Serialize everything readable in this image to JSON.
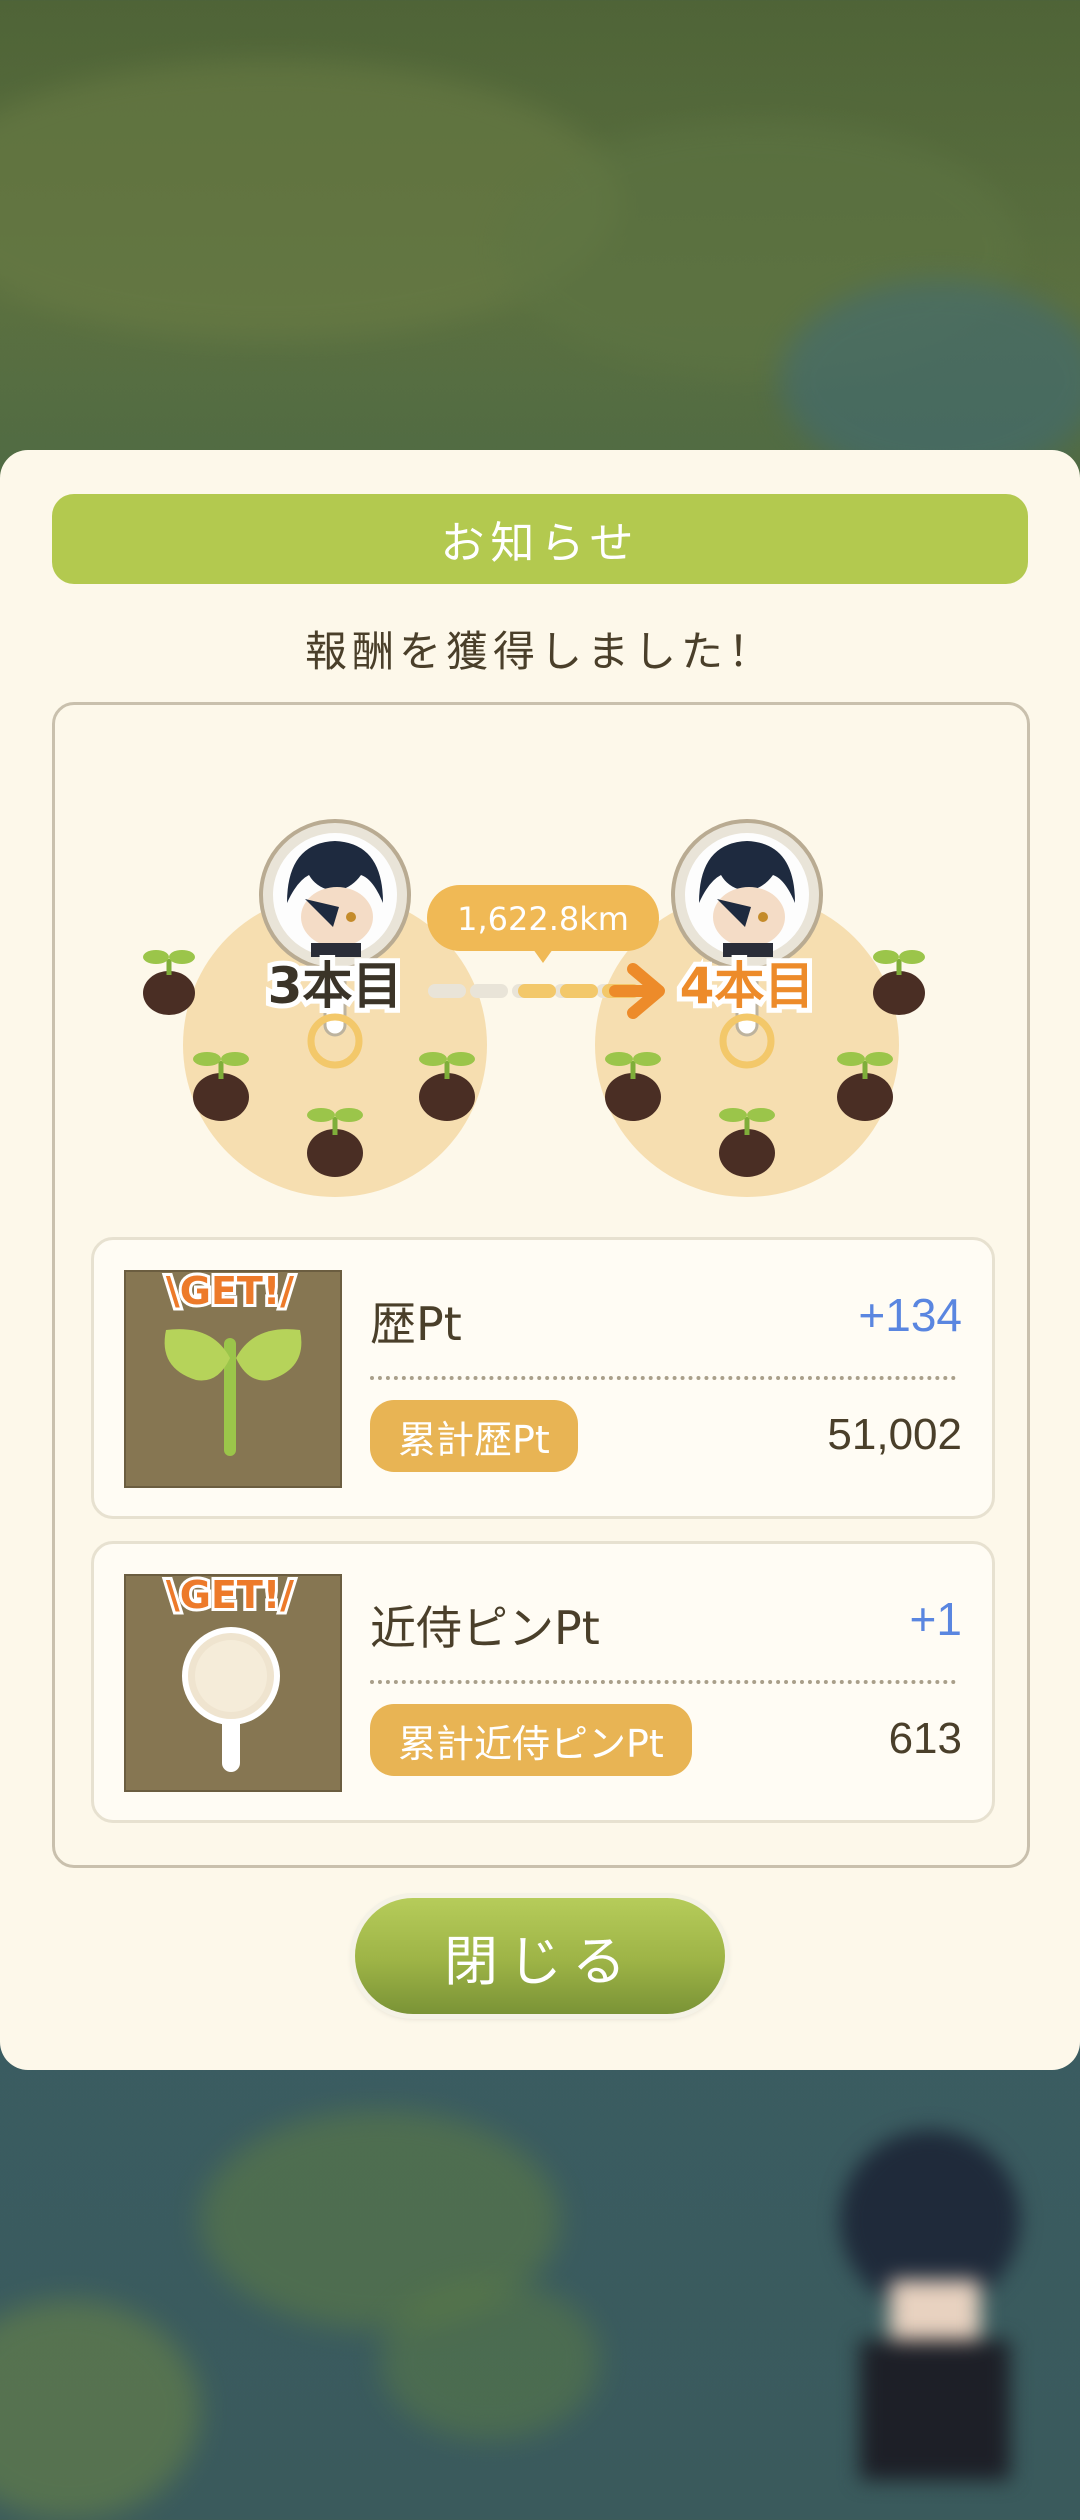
{
  "dialog": {
    "title": "お知らせ",
    "message": "報酬を獲得しました！",
    "close_label": "閉じる"
  },
  "route": {
    "distance": "1,622.8km",
    "from_label": "3本目",
    "to_label": "4本目"
  },
  "rewards": [
    {
      "name": "歴Pt",
      "gained": "+134",
      "total_label": "累計歴Pt",
      "total_value": "51,002",
      "badge": "\\GET!/",
      "icon": "sprout-icon"
    },
    {
      "name": "近侍ピンPt",
      "gained": "+1",
      "total_label": "累計近侍ピンPt",
      "total_value": "613",
      "badge": "\\GET!/",
      "icon": "pin-icon"
    }
  ],
  "colors": {
    "header": "#b3c94f",
    "accent_orange": "#e8b454",
    "plus_blue": "#5a86e0",
    "panel": "#fdf8ea"
  }
}
